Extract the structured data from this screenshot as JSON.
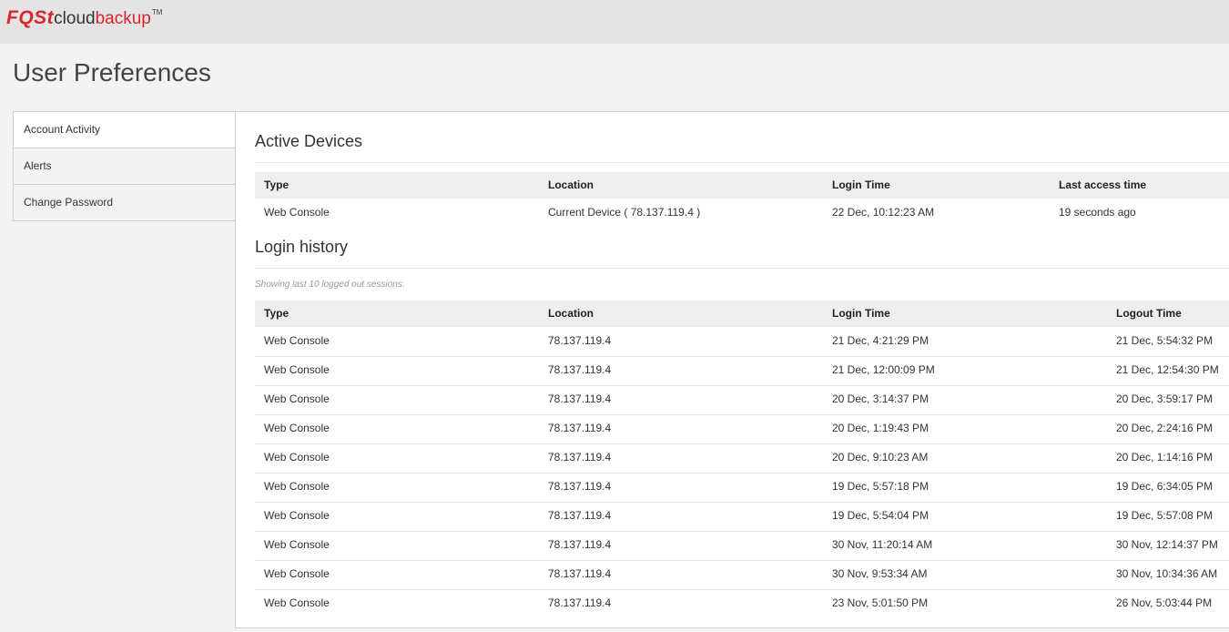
{
  "brand": {
    "fast": "FQSt",
    "cloud": "cloud",
    "backup": "backup",
    "tm": "TM"
  },
  "page_title": "User Preferences",
  "sidebar": {
    "items": [
      {
        "label": "Account Activity"
      },
      {
        "label": "Alerts"
      },
      {
        "label": "Change Password"
      }
    ]
  },
  "active_devices": {
    "title": "Active Devices",
    "columns": [
      "Type",
      "Location",
      "Login Time",
      "Last access time"
    ],
    "rows": [
      {
        "type": "Web Console",
        "location": "Current Device ( 78.137.119.4 )",
        "login": "22 Dec, 10:12:23 AM",
        "last": "19 seconds ago"
      }
    ]
  },
  "login_history": {
    "title": "Login history",
    "note": "Showing last 10 logged out sessions.",
    "columns": [
      "Type",
      "Location",
      "Login Time",
      "Logout Time"
    ],
    "rows": [
      {
        "type": "Web Console",
        "location": "78.137.119.4",
        "login": "21 Dec, 4:21:29 PM",
        "logout": "21 Dec, 5:54:32 PM"
      },
      {
        "type": "Web Console",
        "location": "78.137.119.4",
        "login": "21 Dec, 12:00:09 PM",
        "logout": "21 Dec, 12:54:30 PM"
      },
      {
        "type": "Web Console",
        "location": "78.137.119.4",
        "login": "20 Dec, 3:14:37 PM",
        "logout": "20 Dec, 3:59:17 PM"
      },
      {
        "type": "Web Console",
        "location": "78.137.119.4",
        "login": "20 Dec, 1:19:43 PM",
        "logout": "20 Dec, 2:24:16 PM"
      },
      {
        "type": "Web Console",
        "location": "78.137.119.4",
        "login": "20 Dec, 9:10:23 AM",
        "logout": "20 Dec, 1:14:16 PM"
      },
      {
        "type": "Web Console",
        "location": "78.137.119.4",
        "login": "19 Dec, 5:57:18 PM",
        "logout": "19 Dec, 6:34:05 PM"
      },
      {
        "type": "Web Console",
        "location": "78.137.119.4",
        "login": "19 Dec, 5:54:04 PM",
        "logout": "19 Dec, 5:57:08 PM"
      },
      {
        "type": "Web Console",
        "location": "78.137.119.4",
        "login": "30 Nov, 11:20:14 AM",
        "logout": "30 Nov, 12:14:37 PM"
      },
      {
        "type": "Web Console",
        "location": "78.137.119.4",
        "login": "30 Nov, 9:53:34 AM",
        "logout": "30 Nov, 10:34:36 AM"
      },
      {
        "type": "Web Console",
        "location": "78.137.119.4",
        "login": "23 Nov, 5:01:50 PM",
        "logout": "26 Nov, 5:03:44 PM"
      }
    ]
  }
}
